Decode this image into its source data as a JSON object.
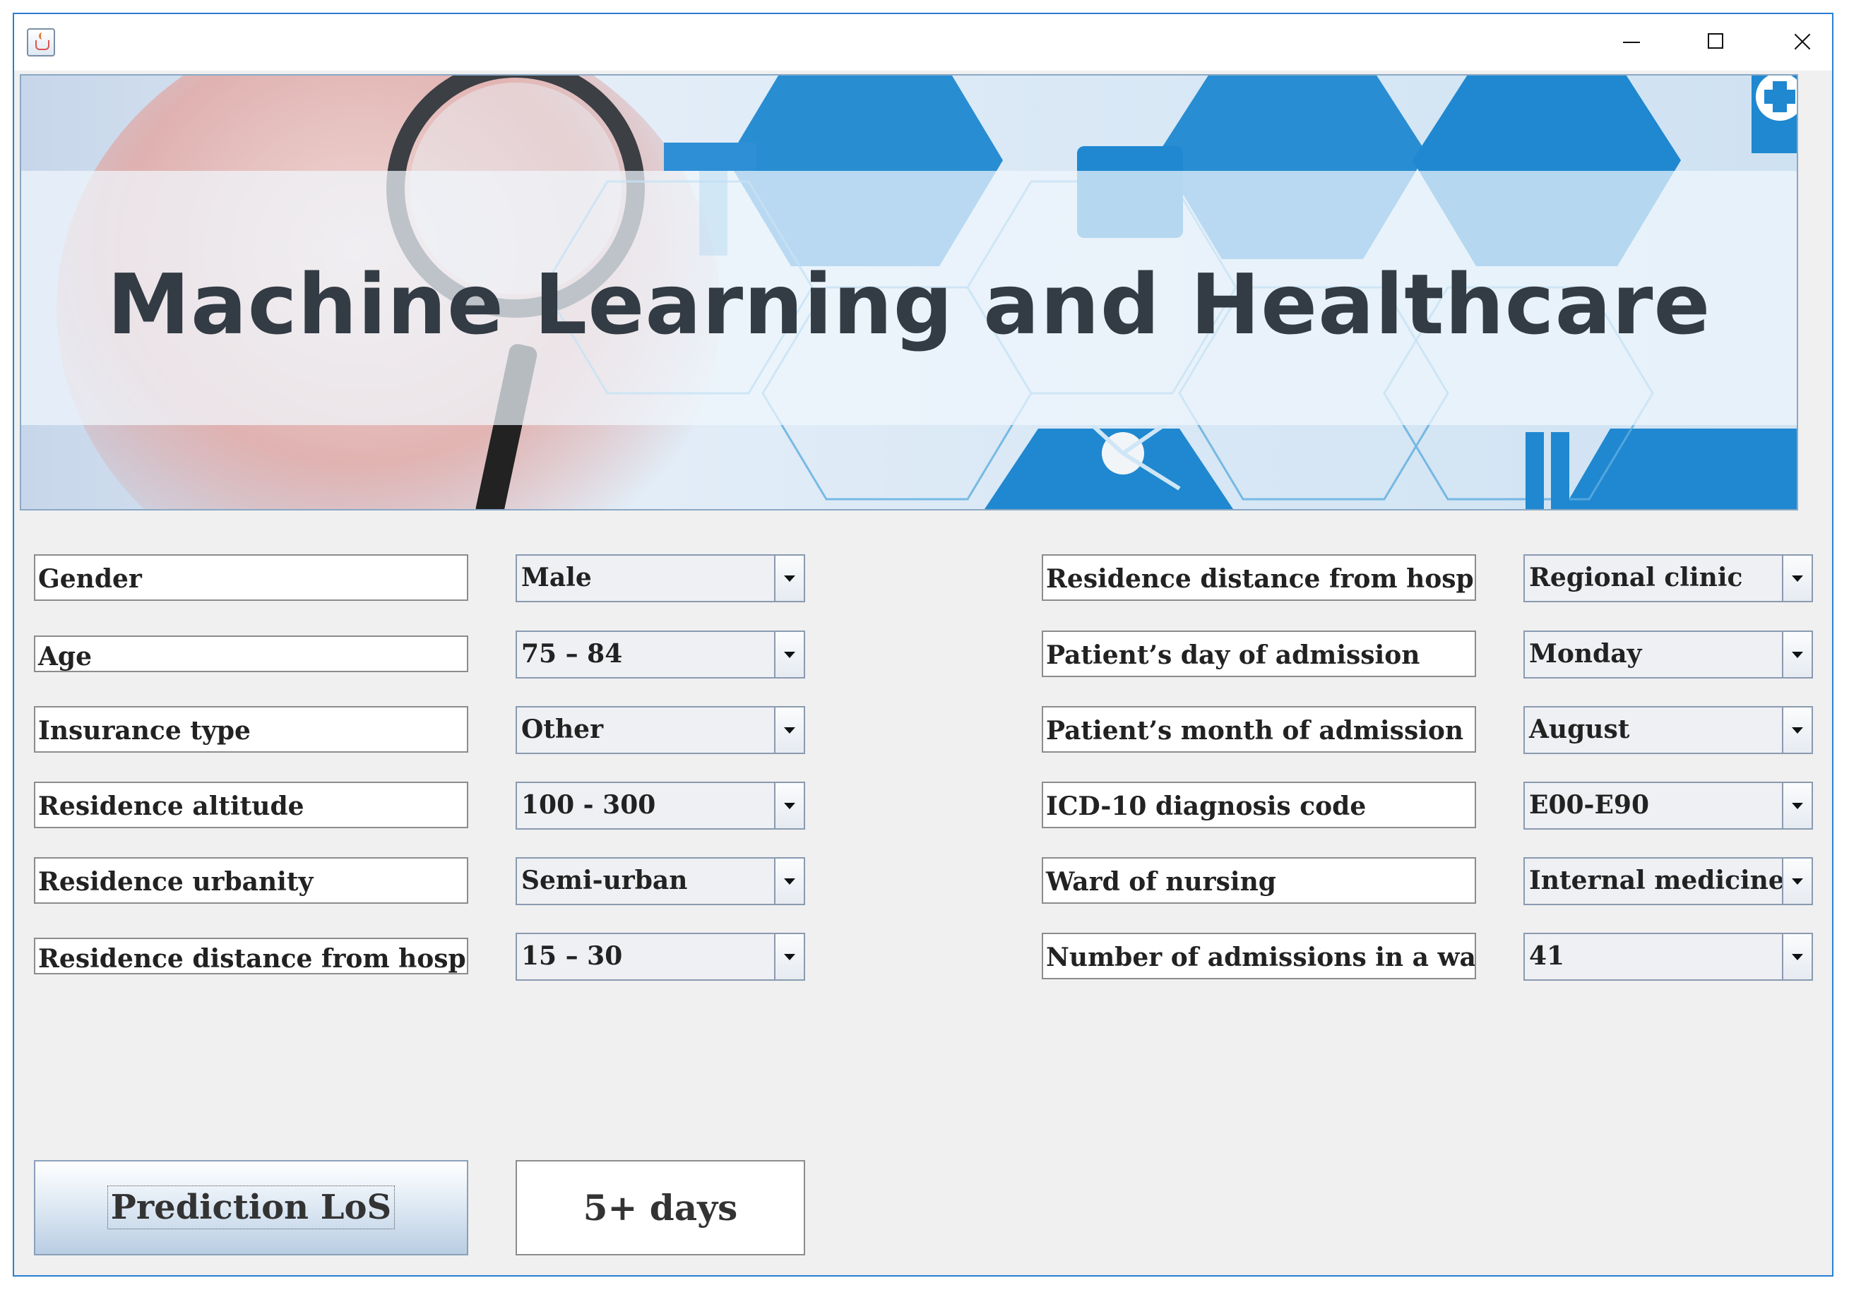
{
  "window": {
    "controls": [
      "minimize",
      "maximize",
      "close"
    ]
  },
  "banner": {
    "title": "Machine Learning and Healthcare"
  },
  "left_fields": [
    {
      "label": "Gender",
      "value": "Male"
    },
    {
      "label": "Age",
      "value": "75 – 84"
    },
    {
      "label": "Insurance type",
      "value": "Other"
    },
    {
      "label": "Residence altitude",
      "value": "100 - 300"
    },
    {
      "label": "Residence urbanity",
      "value": "Semi-urban"
    },
    {
      "label": "Residence distance from hospital",
      "value": "15 – 30"
    }
  ],
  "right_fields": [
    {
      "label": "Residence distance from hospital",
      "value": "Regional clinic"
    },
    {
      "label": "Patient’s day of admission",
      "value": "Monday"
    },
    {
      "label": "Patient’s month of admission",
      "value": "August"
    },
    {
      "label": "ICD-10 diagnosis code",
      "value": "E00-E90"
    },
    {
      "label": "Ward of nursing",
      "value": "Internal medicine"
    },
    {
      "label": "Number of admissions in a ward",
      "value": "41"
    }
  ],
  "actions": {
    "predict_label": "Prediction LoS",
    "result": "5+ days"
  },
  "colors": {
    "accent": "#1f88d0",
    "title_text": "#333b44",
    "window_border": "#2a7fd4"
  }
}
